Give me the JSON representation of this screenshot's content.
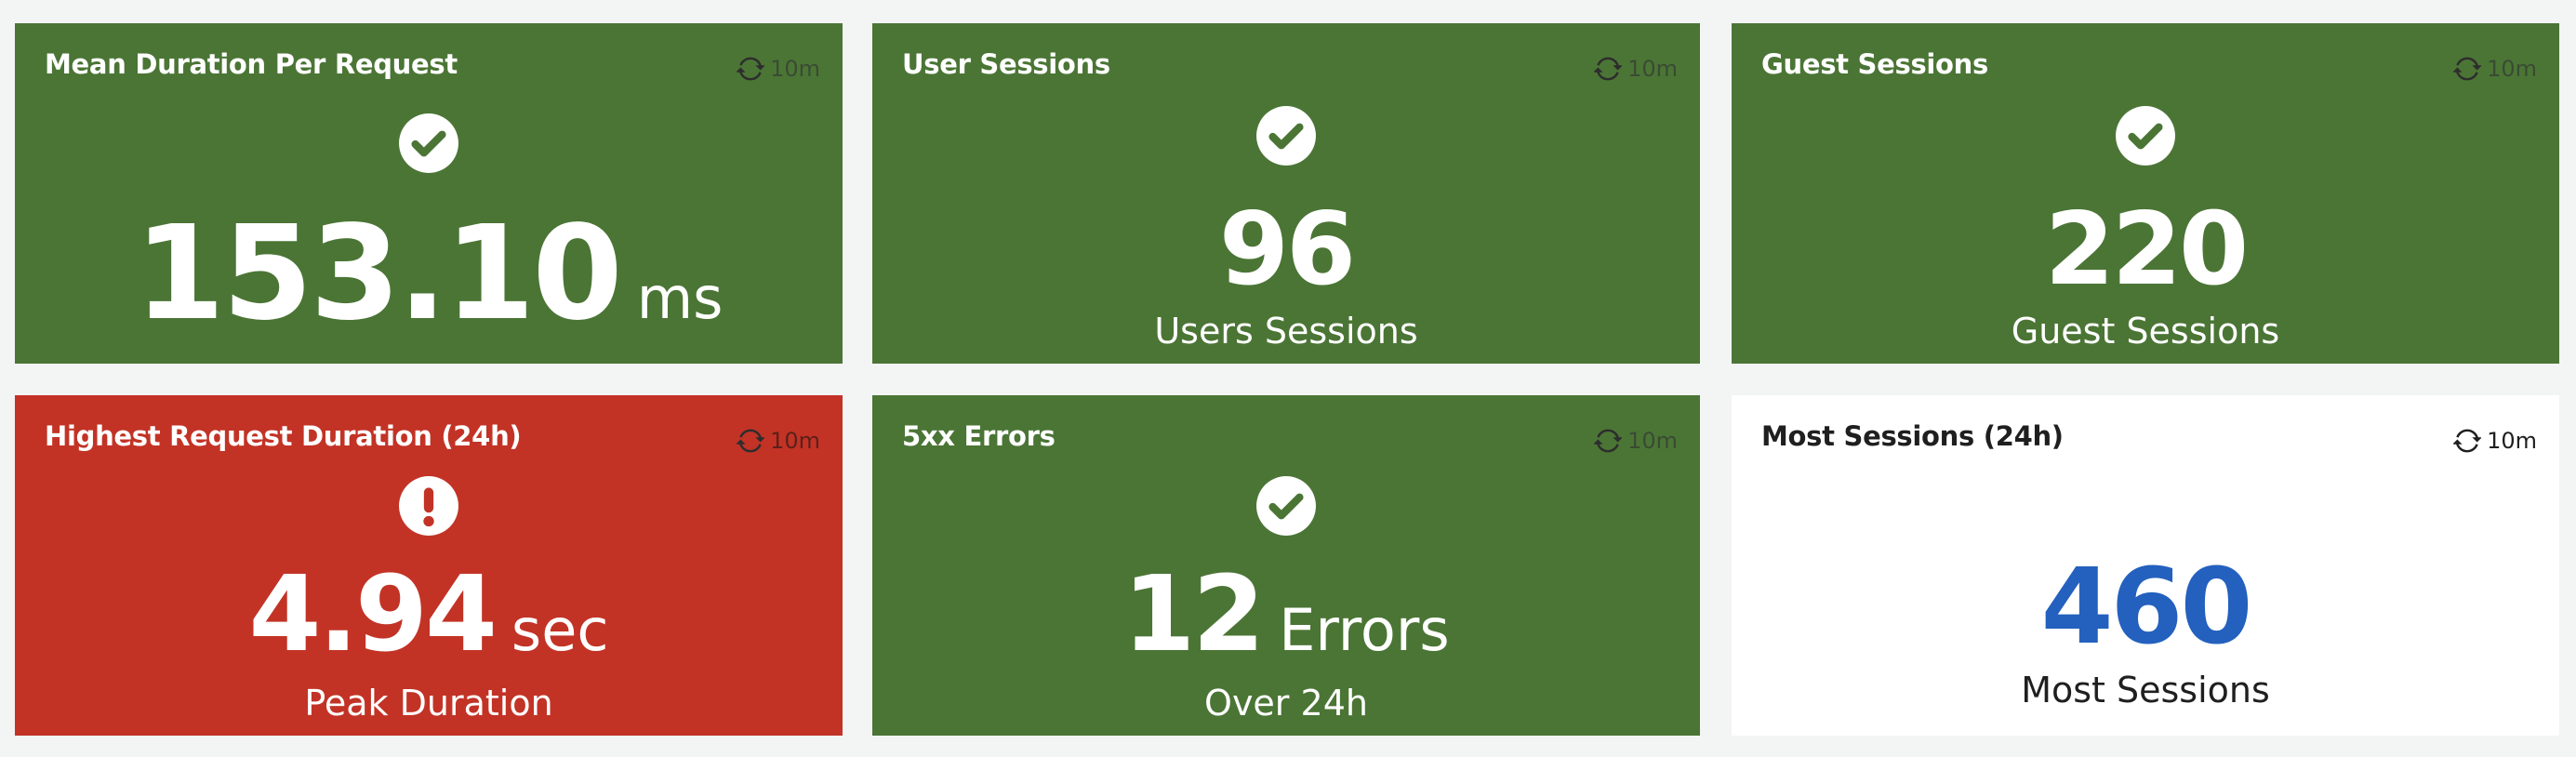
{
  "colors": {
    "ok": "#4b7535",
    "critical": "#c23326",
    "neutral": "#ffffff",
    "value_blue": "#2460be",
    "page_bg": "#f3f4f4"
  },
  "tiles": [
    {
      "title": "Mean Duration Per Request",
      "refresh": "10m",
      "status": "ok",
      "status_icon": "check-circle-icon",
      "value": "153.10",
      "unit": "ms",
      "caption": ""
    },
    {
      "title": "User Sessions",
      "refresh": "10m",
      "status": "ok",
      "status_icon": "check-circle-icon",
      "value": "96",
      "unit": "",
      "caption": "Users Sessions"
    },
    {
      "title": "Guest Sessions",
      "refresh": "10m",
      "status": "ok",
      "status_icon": "check-circle-icon",
      "value": "220",
      "unit": "",
      "caption": "Guest Sessions"
    },
    {
      "title": "Highest Request Duration (24h)",
      "refresh": "10m",
      "status": "critical",
      "status_icon": "exclamation-circle-icon",
      "value": "4.94",
      "unit": "sec",
      "caption": "Peak Duration"
    },
    {
      "title": "5xx Errors",
      "refresh": "10m",
      "status": "ok",
      "status_icon": "check-circle-icon",
      "value": "12",
      "unit": "Errors",
      "caption": "Over 24h"
    },
    {
      "title": "Most Sessions (24h)",
      "refresh": "10m",
      "status": "neutral",
      "status_icon": "",
      "value": "460",
      "unit": "",
      "caption": "Most Sessions"
    }
  ]
}
